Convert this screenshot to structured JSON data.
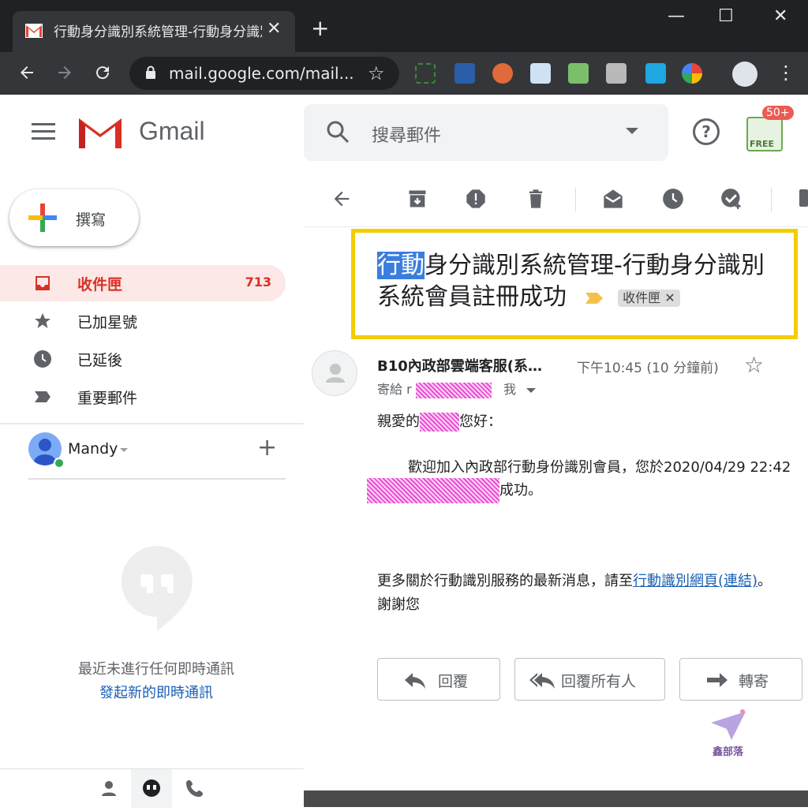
{
  "browser": {
    "tab_title": "行動身分識別系統管理-行動身分識別",
    "url": "mail.google.com/mail...",
    "new_tab": "+",
    "close_tab": "✕",
    "window_controls": {
      "minimize": "—",
      "maximize": "☐",
      "close": "✕"
    }
  },
  "gmail": {
    "brand": "Gmail",
    "search_placeholder": "搜尋郵件",
    "help": "?",
    "ext_badge": "50+",
    "ext_label": "FREE"
  },
  "sidebar": {
    "compose_label": "撰寫",
    "items": [
      {
        "label": "收件匣",
        "count": "713",
        "icon": "inbox-icon"
      },
      {
        "label": "已加星號",
        "icon": "star-icon"
      },
      {
        "label": "已延後",
        "icon": "clock-icon"
      },
      {
        "label": "重要郵件",
        "icon": "important-icon"
      }
    ],
    "hangouts_user": "Mandy",
    "hangouts_empty": "最近未進行任何即時通訊",
    "hangouts_start": "發起新的即時通訊"
  },
  "message": {
    "subject_highlight": "行動",
    "subject_rest": "身分識別系統管理-行動身分識別系統會員註冊成功",
    "label_chip": "收件匣",
    "sender": "B10內政部雲端客服(系…",
    "time": "下午10:45 (10 分鐘前)",
    "to_prefix": "寄給 r",
    "to_me": "我",
    "greeting_prefix": "親愛的",
    "greeting_suffix": "您好：",
    "line1": "歡迎加入內政部行動身份識別會員，您於2020/04/29 22:42",
    "line2_suffix": "成功。",
    "more_info": "更多關於行動識別服務的最新消息，請至",
    "more_link": "行動識別網頁(連結)",
    "more_end": "。",
    "thanks": "謝謝您",
    "reply": "回覆",
    "reply_all": "回覆所有人",
    "forward": "轉寄",
    "watermark": "鑫部落"
  },
  "colors": {
    "highlight_box": "#f2cd00",
    "inbox_active": "#d93025",
    "link": "#1a5fb4"
  }
}
